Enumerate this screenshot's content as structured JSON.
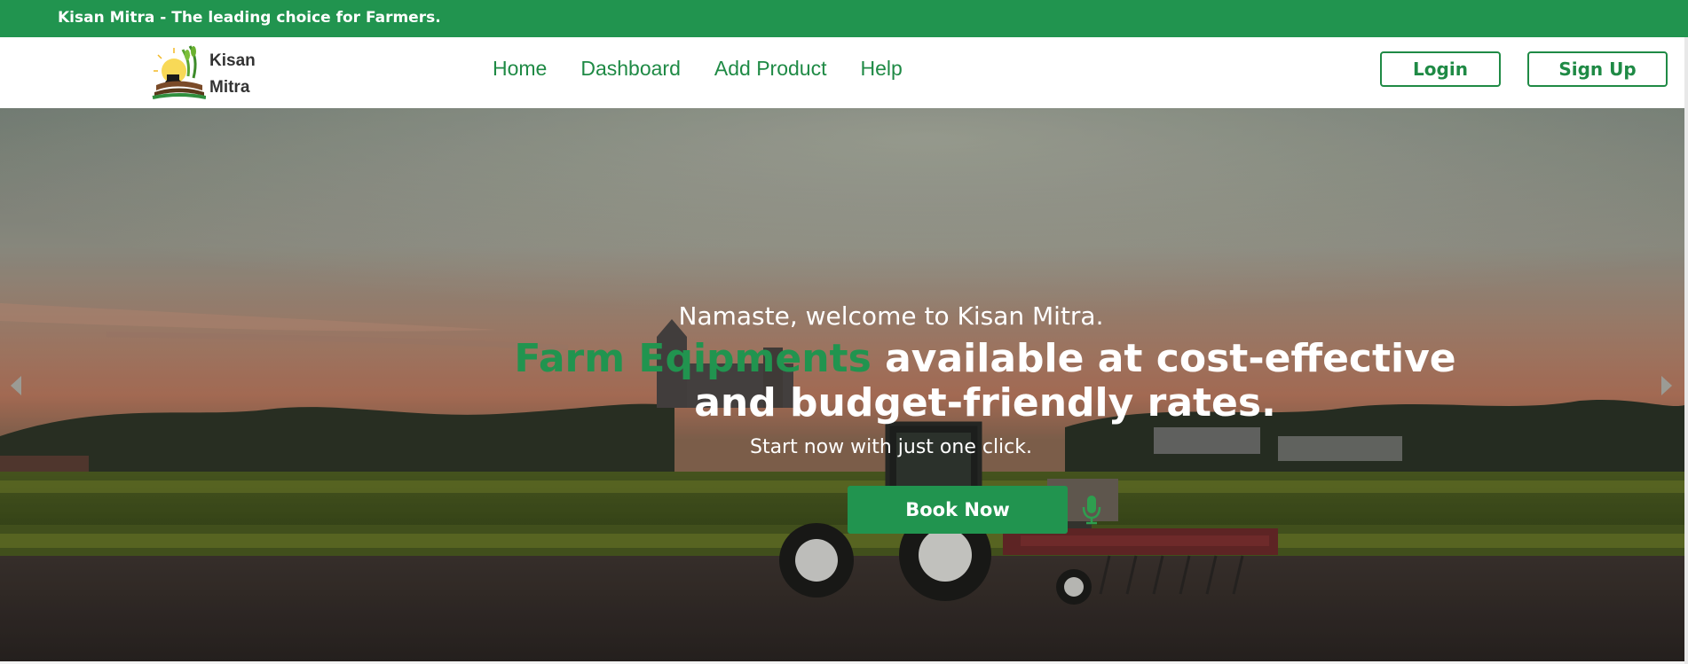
{
  "topbar": {
    "tagline": "Kisan Mitra - The leading choice for Farmers."
  },
  "brand": {
    "line1": "Kisan",
    "line2": "Mitra",
    "logo_icon": "kisan-mitra-logo"
  },
  "nav": {
    "links": [
      {
        "label": "Home"
      },
      {
        "label": "Dashboard"
      },
      {
        "label": "Add Product"
      },
      {
        "label": "Help"
      }
    ],
    "login_label": "Login",
    "signup_label": "Sign Up"
  },
  "hero": {
    "greeting": "Namaste, welcome to Kisan Mitra.",
    "headline_accent": "Farm Eqipments",
    "headline_rest": " available at cost-effective and budget-friendly rates.",
    "subline": "Start now with just one click.",
    "cta_label": "Book Now",
    "mic_icon": "microphone-icon",
    "prev_icon": "carousel-prev-icon",
    "next_icon": "carousel-next-icon"
  },
  "colors": {
    "brand_green": "#21944f",
    "link_green": "#1f8a45"
  }
}
